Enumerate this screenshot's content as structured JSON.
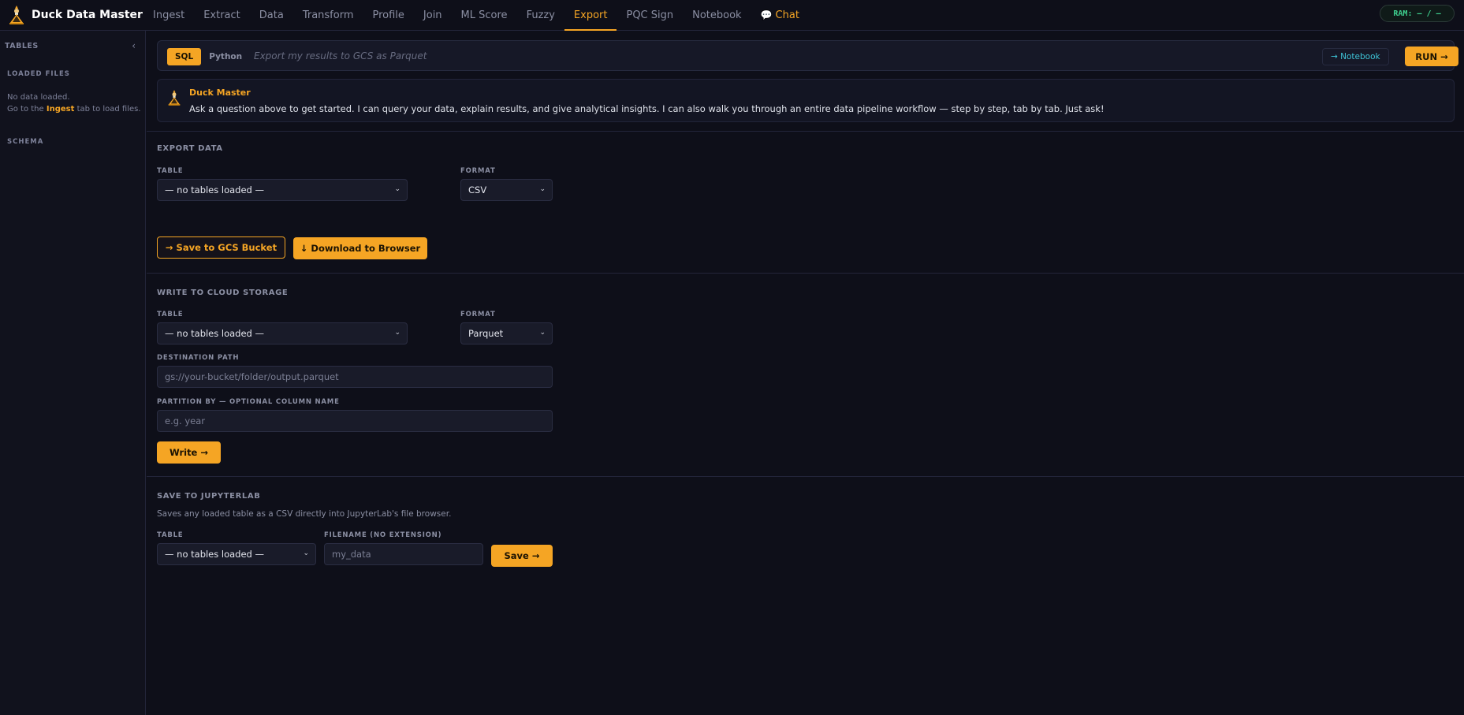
{
  "app": {
    "title": "Duck Data Master",
    "ram_label": "RAM: – / –"
  },
  "nav": {
    "tabs": [
      {
        "label": "Ingest"
      },
      {
        "label": "Extract"
      },
      {
        "label": "Data"
      },
      {
        "label": "Transform"
      },
      {
        "label": "Profile"
      },
      {
        "label": "Join"
      },
      {
        "label": "ML Score"
      },
      {
        "label": "Fuzzy"
      },
      {
        "label": "Export"
      },
      {
        "label": "PQC Sign"
      },
      {
        "label": "Notebook"
      },
      {
        "label": "Chat"
      }
    ],
    "active": "Export"
  },
  "sidebar": {
    "title": "TABLES",
    "loaded_files_label": "LOADED FILES",
    "empty_line1": "No data loaded.",
    "empty_prefix": "Go to the",
    "empty_link": "Ingest",
    "empty_suffix": "tab to load files.",
    "schema_label": "SCHEMA"
  },
  "query": {
    "sql_label": "SQL",
    "python_label": "Python",
    "placeholder": "Export my results to GCS as Parquet",
    "notebook_label": "→ Notebook",
    "run_label": "RUN →"
  },
  "assistant": {
    "name": "Duck Master",
    "message": "Ask a question above to get started. I can query your data, explain results, and give analytical insights. I can also walk you through an entire data pipeline workflow — step by step, tab by tab. Just ask!"
  },
  "export_data": {
    "title": "EXPORT DATA",
    "table_label": "TABLE",
    "table_value": "— no tables loaded —",
    "format_label": "FORMAT",
    "format_value": "CSV",
    "gcs_button": "→ Save to GCS Bucket",
    "download_button": "↓ Download to Browser"
  },
  "cloud_storage": {
    "title": "WRITE TO CLOUD STORAGE",
    "table_label": "TABLE",
    "table_value": "— no tables loaded —",
    "format_label": "FORMAT",
    "format_value": "Parquet",
    "dest_label": "DESTINATION PATH",
    "dest_placeholder": "gs://your-bucket/folder/output.parquet",
    "partition_label": "PARTITION BY — OPTIONAL COLUMN NAME",
    "partition_placeholder": "e.g. year",
    "write_button": "Write →"
  },
  "jupyter": {
    "title": "SAVE TO JUPYTERLAB",
    "description": "Saves any loaded table as a CSV directly into JupyterLab's file browser.",
    "table_label": "TABLE",
    "table_value": "— no tables loaded —",
    "filename_label": "FILENAME (NO EXTENSION)",
    "filename_placeholder": "my_data",
    "save_button": "Save →"
  },
  "colors": {
    "accent": "#f5a524",
    "background": "#0e0f19",
    "sidebar": "#11121d",
    "ram_green": "#3ecf8e",
    "link_cyan": "#3ec3d6"
  }
}
